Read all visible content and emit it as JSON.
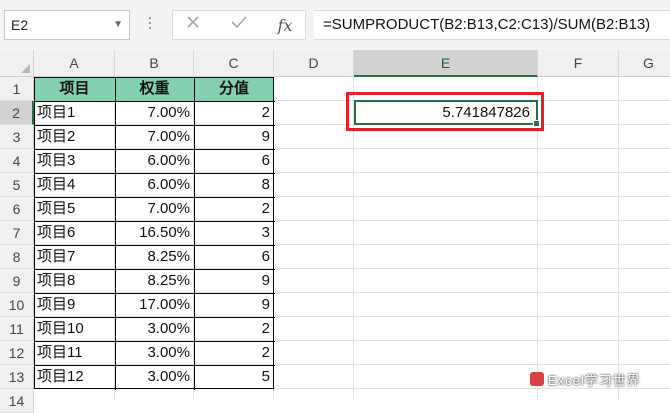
{
  "formula_bar": {
    "name_box": "E2",
    "fx_label": "fx",
    "formula": "=SUMPRODUCT(B2:B13,C2:C13)/SUM(B2:B13)"
  },
  "columns": [
    "A",
    "B",
    "C",
    "D",
    "E",
    "F",
    "G"
  ],
  "rows": [
    "1",
    "2",
    "3",
    "4",
    "5",
    "6",
    "7",
    "8",
    "9",
    "10",
    "11",
    "12",
    "13",
    "14"
  ],
  "table": {
    "headers": [
      "项目",
      "权重",
      "分值"
    ],
    "header_color": "#84d0b0",
    "data": [
      {
        "item": "项目1",
        "weight": "7.00%",
        "score": "2"
      },
      {
        "item": "项目2",
        "weight": "7.00%",
        "score": "9"
      },
      {
        "item": "项目3",
        "weight": "6.00%",
        "score": "6"
      },
      {
        "item": "项目4",
        "weight": "6.00%",
        "score": "8"
      },
      {
        "item": "项目5",
        "weight": "7.00%",
        "score": "2"
      },
      {
        "item": "项目6",
        "weight": "16.50%",
        "score": "3"
      },
      {
        "item": "项目7",
        "weight": "8.25%",
        "score": "6"
      },
      {
        "item": "项目8",
        "weight": "8.25%",
        "score": "9"
      },
      {
        "item": "项目9",
        "weight": "17.00%",
        "score": "9"
      },
      {
        "item": "项目10",
        "weight": "3.00%",
        "score": "2"
      },
      {
        "item": "项目11",
        "weight": "3.00%",
        "score": "2"
      },
      {
        "item": "项目12",
        "weight": "3.00%",
        "score": "5"
      }
    ]
  },
  "selected_cell": {
    "ref": "E2",
    "value": "5.741847826",
    "highlight_color": "#e0202a"
  },
  "watermark": "Excel学习世界"
}
